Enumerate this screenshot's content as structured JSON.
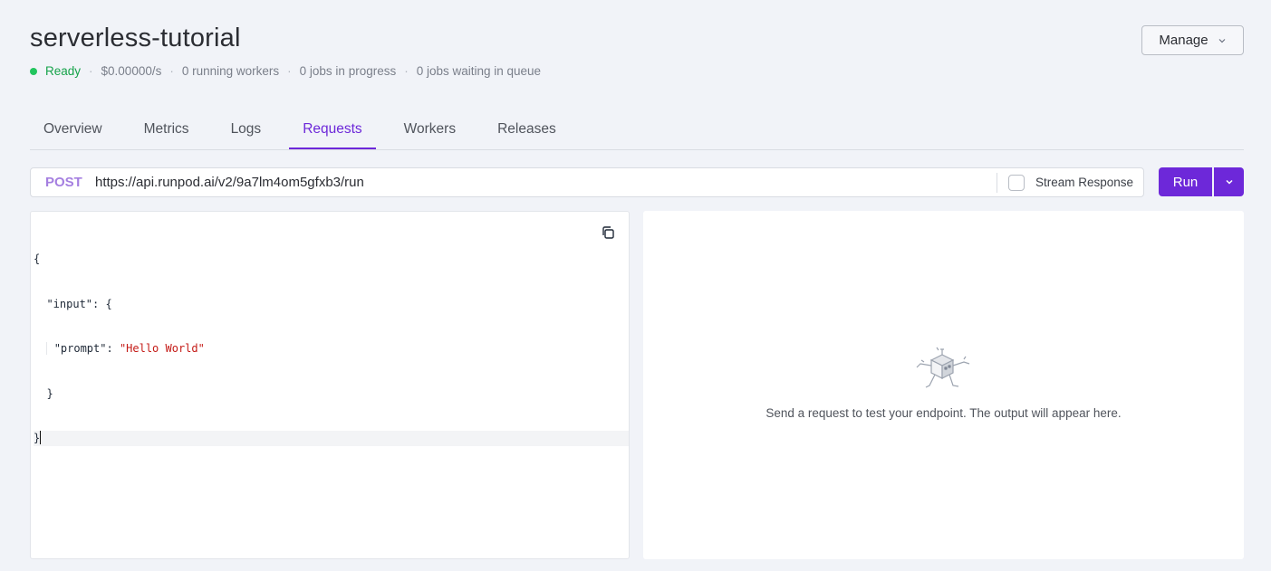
{
  "header": {
    "title": "serverless-tutorial",
    "status": "Ready",
    "rate": "$0.00000/s",
    "running_workers": "0 running workers",
    "jobs_in_progress": "0 jobs in progress",
    "jobs_waiting": "0 jobs waiting in queue",
    "separator": "·",
    "manage_label": "Manage",
    "status_color": "#22c55e"
  },
  "tabs": [
    {
      "label": "Overview",
      "active": false
    },
    {
      "label": "Metrics",
      "active": false
    },
    {
      "label": "Logs",
      "active": false
    },
    {
      "label": "Requests",
      "active": true
    },
    {
      "label": "Workers",
      "active": false
    },
    {
      "label": "Releases",
      "active": false
    }
  ],
  "request": {
    "method": "POST",
    "url": "https://api.runpod.ai/v2/9a7lm4om5gfxb3/run",
    "stream_label": "Stream Response",
    "stream_checked": false,
    "run_label": "Run"
  },
  "editor": {
    "open_brace": "{",
    "input_key": "\"input\"",
    "input_open": ": {",
    "prompt_key": "\"prompt\"",
    "colon": ": ",
    "prompt_value": "\"Hello World\"",
    "inner_close": "}",
    "close_brace": "}"
  },
  "output": {
    "empty_message": "Send a request to test your endpoint. The output will appear here."
  },
  "colors": {
    "accent": "#6d28d9",
    "method": "#a57fe0",
    "string": "#c41a16"
  }
}
